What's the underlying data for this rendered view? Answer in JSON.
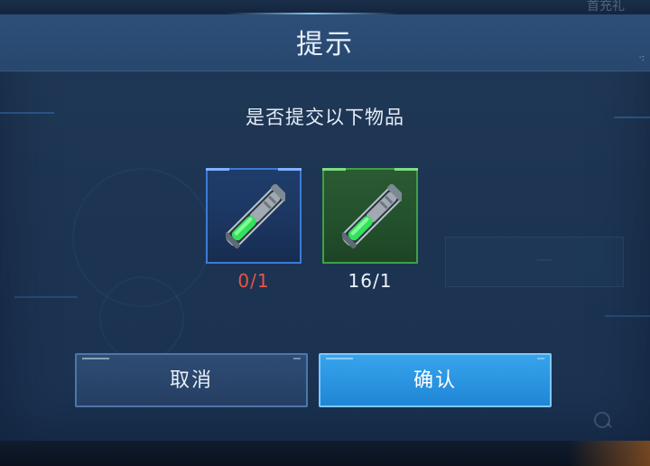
{
  "background": {
    "corner_text": "首充礼"
  },
  "dialog": {
    "title": "提示",
    "prompt": "是否提交以下物品",
    "items": [
      {
        "icon": "green-vial-icon",
        "count": "0/1",
        "frame_color": "#3d7bd6",
        "count_color": "#ec5346"
      },
      {
        "icon": "green-vial-icon",
        "count": "16/1",
        "frame_color": "#3fa046",
        "count_color": "#eef3fa"
      }
    ],
    "buttons": {
      "cancel_label": "取消",
      "confirm_label": "确认"
    }
  },
  "colors": {
    "accent_blue": "#1f86d6",
    "warning_red": "#ec5346",
    "success_green": "#3fa046"
  }
}
